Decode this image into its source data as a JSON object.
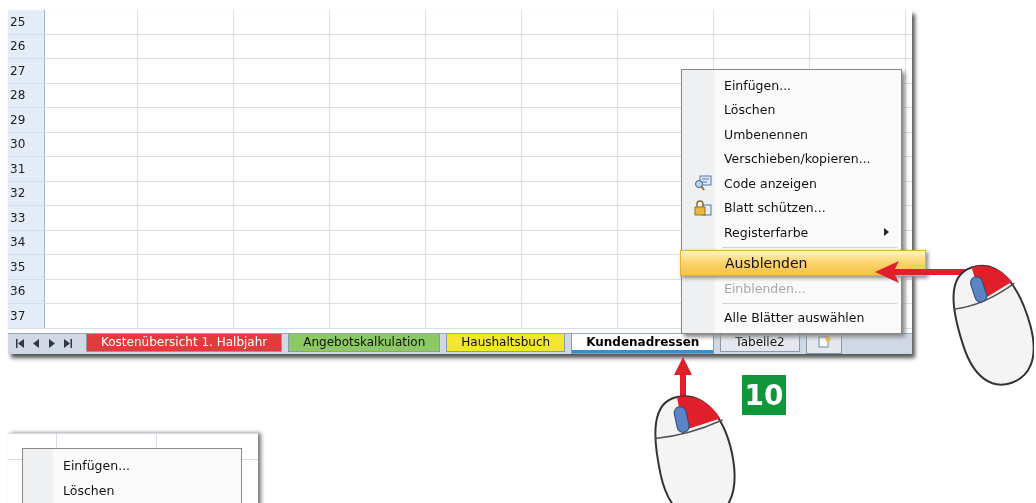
{
  "sheet": {
    "rows": [
      "25",
      "26",
      "27",
      "28",
      "29",
      "30",
      "31",
      "32",
      "33",
      "34",
      "35",
      "36",
      "37"
    ]
  },
  "sheet_tabs": [
    {
      "label": "Kostenübersicht 1. Halbjahr",
      "color": "#e23b3b",
      "selected": false
    },
    {
      "label": "Angebotskalkulation",
      "color": "#8cc863",
      "selected": false
    },
    {
      "label": "Haushaltsbuch",
      "color": "#f2e630",
      "selected": false
    },
    {
      "label": "Kundenadressen",
      "color": "#2f8fd8",
      "selected": true
    },
    {
      "label": "Tabelle2",
      "color": "#e4e8ee",
      "selected": false
    }
  ],
  "context_menu": {
    "items": [
      {
        "kind": "plain",
        "label": "Einfügen...",
        "selected": false,
        "disabled": false
      },
      {
        "kind": "plain",
        "label": "Löschen",
        "selected": false,
        "disabled": false
      },
      {
        "kind": "plain",
        "label": "Umbenennen",
        "selected": false,
        "disabled": false
      },
      {
        "kind": "plain",
        "label": "Verschieben/kopieren...",
        "selected": false,
        "disabled": false
      },
      {
        "kind": "view-code",
        "label": "Code anzeigen",
        "selected": false,
        "disabled": false
      },
      {
        "kind": "protect",
        "label": "Blatt schützen...",
        "selected": false,
        "disabled": false
      },
      {
        "kind": "submenu",
        "label": "Registerfarbe",
        "selected": false,
        "disabled": false
      },
      {
        "kind": "separator"
      },
      {
        "kind": "plain",
        "label": "Ausblenden",
        "selected": true,
        "disabled": false
      },
      {
        "kind": "plain",
        "label": "Einblenden...",
        "selected": false,
        "disabled": true
      },
      {
        "kind": "separator"
      },
      {
        "kind": "plain",
        "label": "Alle Blätter auswählen",
        "selected": false,
        "disabled": false
      }
    ]
  },
  "step_badge": "10",
  "second_menu": {
    "items": [
      {
        "label": "Einfügen..."
      },
      {
        "label": "Löschen"
      }
    ]
  }
}
